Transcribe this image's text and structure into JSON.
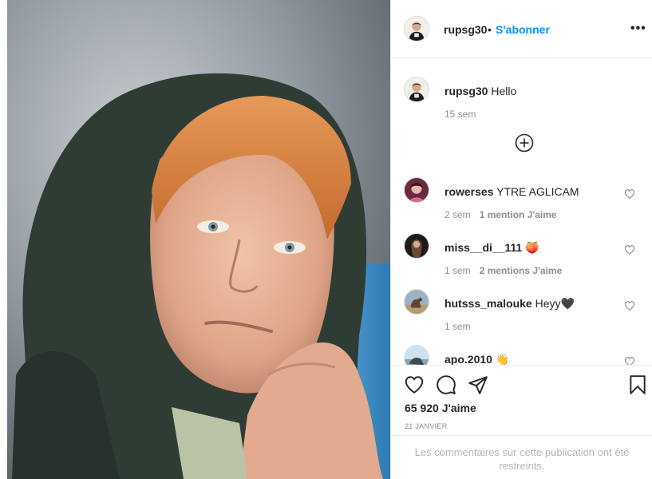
{
  "post": {
    "author": "rupsg30",
    "separator": "•",
    "follow_label": "S'abonner",
    "more_label": "•••"
  },
  "caption": {
    "username": "rupsg30",
    "text": "Hello",
    "time": "15 sem"
  },
  "comments": [
    {
      "username": "rowerses",
      "text": "YTRE AGLICAM",
      "time": "2 sem",
      "likes": "1 mention J'aime"
    },
    {
      "username": "miss__di__111",
      "text": "🍑",
      "time": "1 sem",
      "likes": "2 mentions J'aime"
    },
    {
      "username": "hutsss_malouke",
      "text": "Heyy🖤",
      "time": "1 sem",
      "likes": ""
    },
    {
      "username": "apo.2010",
      "text": "👋",
      "time": "",
      "likes": ""
    }
  ],
  "footer": {
    "likes_count": "65 920 J'aime",
    "date": "21 JANVIER",
    "restricted_notice": "Les commentaires sur cette publication ont été restreints."
  },
  "icons": {
    "like": "heart-outline-icon",
    "comment": "speech-bubble-icon",
    "share": "paper-plane-icon",
    "save": "bookmark-icon",
    "load_more": "plus-circle-icon"
  },
  "colors": {
    "link_blue": "#0095f6",
    "text": "#262626",
    "muted": "#8e8e8e"
  }
}
